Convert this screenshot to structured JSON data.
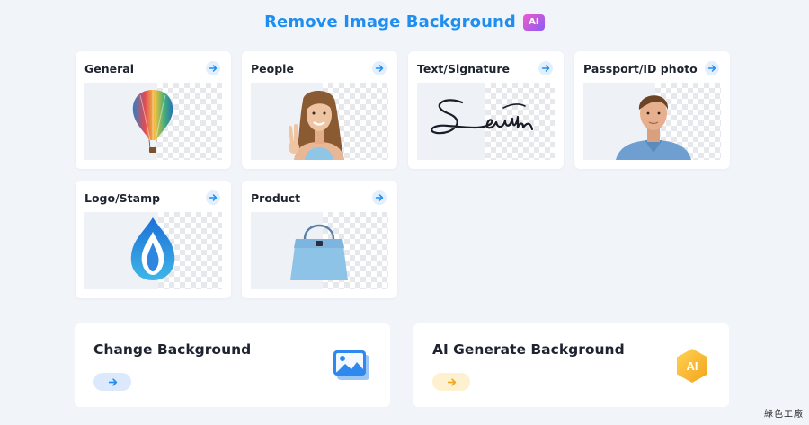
{
  "header": {
    "title": "Remove Image Background",
    "ai_badge": "AI"
  },
  "categories": [
    {
      "label": "General",
      "image": "hot-air-balloon"
    },
    {
      "label": "People",
      "image": "smiling-woman"
    },
    {
      "label": "Text/Signature",
      "image": "handwritten-signature"
    },
    {
      "label": "Passport/ID photo",
      "image": "man-portrait"
    },
    {
      "label": "Logo/Stamp",
      "image": "blue-flame-logo"
    },
    {
      "label": "Product",
      "image": "blue-handbag"
    }
  ],
  "actions": {
    "change_background": {
      "label": "Change Background",
      "accent": "#dce9fc"
    },
    "ai_generate_background": {
      "label": "AI Generate Background",
      "icon_text": "AI",
      "accent": "#fdf1cf"
    }
  },
  "colors": {
    "title": "#1f8ef1",
    "arrow": "#1f8ef1",
    "page_bg": "#f1f4f9"
  },
  "watermark": "綠色工廠"
}
